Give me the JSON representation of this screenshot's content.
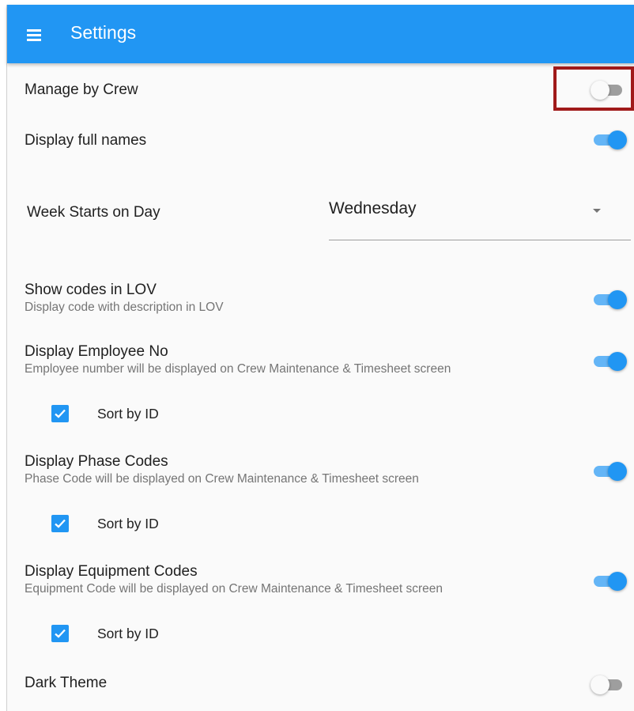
{
  "appbar": {
    "title": "Settings",
    "menu_icon": "menu-icon"
  },
  "settings": {
    "manage_by_crew": {
      "title": "Manage by Crew",
      "enabled": false
    },
    "display_full_names": {
      "title": "Display full names",
      "enabled": true
    },
    "week_start": {
      "label": "Week Starts on Day",
      "value": "Wednesday"
    },
    "show_codes_lov": {
      "title": "Show codes in LOV",
      "subtitle": "Display code with description in LOV",
      "enabled": true
    },
    "display_employee_no": {
      "title": "Display Employee No",
      "subtitle": "Employee number will be displayed on Crew Maintenance & Timesheet screen",
      "enabled": true,
      "sort_label": "Sort by ID",
      "sort_checked": true
    },
    "display_phase_codes": {
      "title": "Display Phase Codes",
      "subtitle": "Phase Code will be displayed on Crew Maintenance & Timesheet screen",
      "enabled": true,
      "sort_label": "Sort by ID",
      "sort_checked": true
    },
    "display_equipment_codes": {
      "title": "Display Equipment Codes",
      "subtitle": "Equipment Code will be displayed on Crew Maintenance & Timesheet screen",
      "enabled": true,
      "sort_label": "Sort by ID",
      "sort_checked": true
    },
    "dark_theme": {
      "title": "Dark Theme",
      "enabled": false
    }
  },
  "colors": {
    "primary": "#2196f3",
    "highlight": "#a01a1a"
  }
}
